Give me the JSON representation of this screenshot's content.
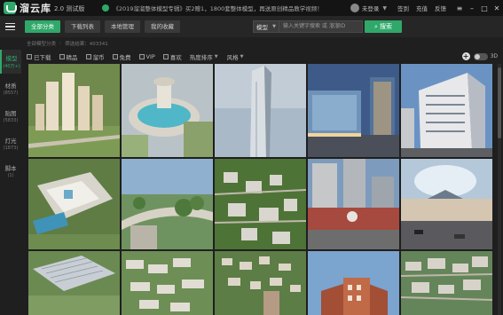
{
  "app": {
    "name": "溜云库",
    "version": "2.0",
    "edition": "测试版"
  },
  "notice": "《2019溜溜整体模型专辑》买2赠1，1800套整体模型，再送原创精品教学视频！",
  "user": {
    "login": "未登录",
    "links": [
      "签到",
      "充值",
      "反馈"
    ]
  },
  "nav": {
    "tabs": [
      "全部分类",
      "下载列表",
      "本地管理",
      "我的收藏"
    ],
    "search": {
      "category": "模型",
      "placeholder": "输入关键字搜索 或 溜溜ID",
      "button": "搜索"
    }
  },
  "breadcrumb": [
    "全部模型分类",
    "筛选结果：403341"
  ],
  "filters": {
    "checks": [
      "已下载",
      "精品",
      "溜币",
      "免费",
      "VIP",
      "喜欢"
    ],
    "sort": "热度排序",
    "style": "风格",
    "toggle_label": "3D"
  },
  "sidebar": [
    {
      "label": "模型",
      "count": "(40万+)"
    },
    {
      "label": "材质",
      "count": "(8557)"
    },
    {
      "label": "贴图",
      "count": "(5833)"
    },
    {
      "label": "灯光",
      "count": "(1873)"
    },
    {
      "label": "脚本",
      "count": "(1)"
    }
  ],
  "colors": {
    "accent": "#2fa86a",
    "background": "#1f1f1f"
  },
  "thumbnails": [
    "residential-towers",
    "fountain-plaza",
    "glass-skyscraper",
    "office-tower-dusk",
    "apartment-highrise",
    "campus-aerial",
    "park-bridge",
    "town-aerial",
    "commercial-towers",
    "street-mall",
    "factory-aerial",
    "housing-estate",
    "village-aerial",
    "brick-building",
    "city-aerial"
  ]
}
